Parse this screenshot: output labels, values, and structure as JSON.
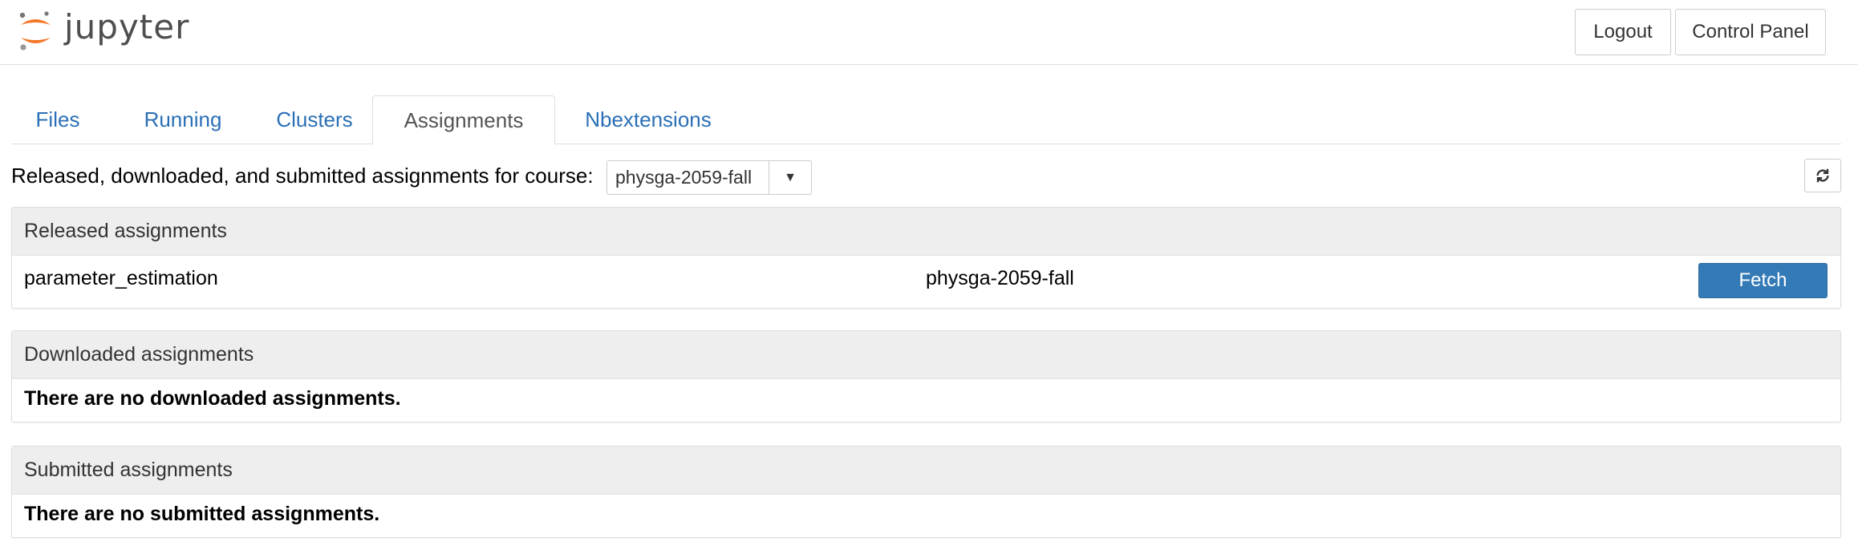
{
  "header": {
    "logo_text": "jupyter",
    "logout_label": "Logout",
    "control_panel_label": "Control Panel"
  },
  "tabs": [
    {
      "label": "Files",
      "active": false
    },
    {
      "label": "Running",
      "active": false
    },
    {
      "label": "Clusters",
      "active": false
    },
    {
      "label": "Assignments",
      "active": true
    },
    {
      "label": "Nbextensions",
      "active": false
    }
  ],
  "course": {
    "label": "Released, downloaded, and submitted assignments for course:",
    "selected": "physga-2059-fall"
  },
  "released": {
    "title": "Released assignments",
    "rows": [
      {
        "name": "parameter_estimation",
        "course": "physga-2059-fall",
        "action": "Fetch"
      }
    ]
  },
  "downloaded": {
    "title": "Downloaded assignments",
    "empty_message": "There are no downloaded assignments."
  },
  "submitted": {
    "title": "Submitted assignments",
    "empty_message": "There are no submitted assignments."
  },
  "colors": {
    "accent": "#337ab7",
    "link": "#2a6fb5",
    "logo_orange": "#f37726"
  }
}
